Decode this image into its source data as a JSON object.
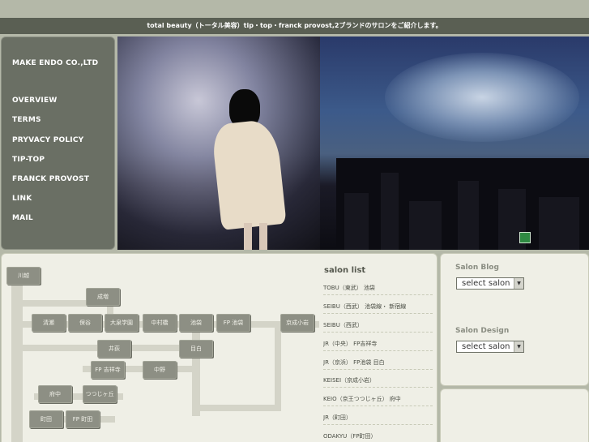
{
  "page": {
    "title_bar": "total beauty（トータル美容）tip・top・franck provost,2ブランドのサロンをご紹介します。"
  },
  "sidebar": {
    "brand": "MAKE ENDO CO.,LTD",
    "items": [
      {
        "label": "OVERVIEW"
      },
      {
        "label": "TERMS"
      },
      {
        "label": "PRYVACY POLICY"
      },
      {
        "label": "TIP-TOP"
      },
      {
        "label": "FRANCK PROVOST"
      },
      {
        "label": "LINK"
      },
      {
        "label": "MAIL"
      }
    ]
  },
  "map": {
    "stations": [
      {
        "label": "川越"
      },
      {
        "label": "成増"
      },
      {
        "label": "清瀬"
      },
      {
        "label": "保谷"
      },
      {
        "label": "大泉学園"
      },
      {
        "label": "中村橋"
      },
      {
        "label": "池袋"
      },
      {
        "label": "FP 池袋"
      },
      {
        "label": "京成小岩"
      },
      {
        "label": "井荻"
      },
      {
        "label": "目白"
      },
      {
        "label": "FP 吉祥寺"
      },
      {
        "label": "中野"
      },
      {
        "label": "府中"
      },
      {
        "label": "つつじヶ丘"
      },
      {
        "label": "町田"
      },
      {
        "label": "FP 町田"
      }
    ]
  },
  "salon_list": {
    "title": "salon list",
    "items": [
      {
        "label": "TOBU（東武） 池袋"
      },
      {
        "label": "SEIBU（西武） 池袋線・ 新宿線"
      },
      {
        "label": "SEIBU（西武）"
      },
      {
        "label": "JR（中央） FP吉祥寺"
      },
      {
        "label": "JR（京浜） FP池袋 目白"
      },
      {
        "label": "KEISEI（京成小岩）"
      },
      {
        "label": "KEIO（京王つつじヶ丘） 府中"
      },
      {
        "label": "JR（町田）"
      },
      {
        "label": "ODAKYU（FP町田）"
      }
    ]
  },
  "salon_blog": {
    "title": "Salon Blog",
    "select_value": "select salon"
  },
  "salon_design": {
    "title": "Salon Design",
    "select_value": "select salon"
  },
  "colors": {
    "background": "#b4b8a8",
    "title_bar": "#5a5f53",
    "sidebar": "#6a6f64",
    "panel": "#efefe6",
    "station": "#8d8f84"
  }
}
